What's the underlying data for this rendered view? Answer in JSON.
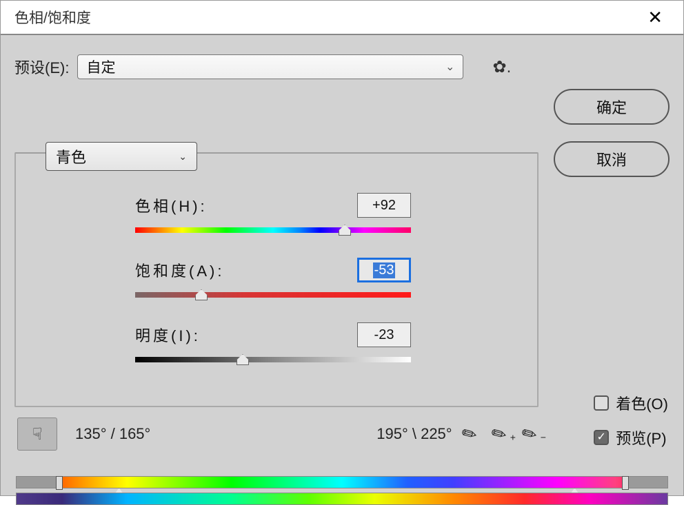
{
  "title": "色相/饱和度",
  "preset": {
    "label": "预设(E):",
    "value": "自定"
  },
  "buttons": {
    "ok": "确定",
    "cancel": "取消"
  },
  "channel": {
    "value": "青色"
  },
  "sliders": {
    "hue": {
      "label": "色相(H):",
      "value": "+92",
      "percent": 76
    },
    "saturation": {
      "label": "饱和度(A):",
      "value": "-53",
      "percent": 24,
      "selected": true
    },
    "lightness": {
      "label": "明度(I):",
      "value": "-23",
      "percent": 39
    }
  },
  "range": {
    "left": "135° / 165°",
    "right": "195° \\ 225°"
  },
  "checks": {
    "colorize": "着色(O)",
    "preview": "预览(P)",
    "colorize_on": false,
    "preview_on": true
  },
  "spectrum": {
    "top": {
      "grey_left_pct": 6,
      "grey_right_pct": 7,
      "marker_a": 6,
      "marker_b": 15,
      "marker_c": 85,
      "marker_d": 93
    },
    "bottom": {}
  }
}
